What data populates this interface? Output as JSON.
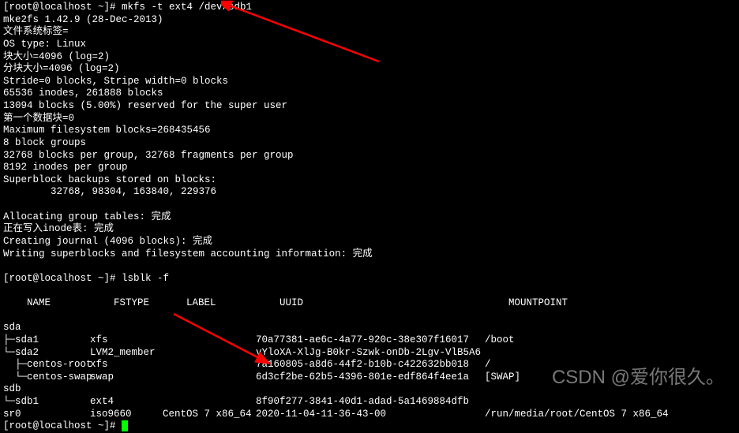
{
  "prompt1": "[root@localhost ~]# ",
  "cmd1": "mkfs -t ext4 /dev/sdb1",
  "mkfs_output": [
    "mke2fs 1.42.9 (28-Dec-2013)",
    "文件系统标签=",
    "OS type: Linux",
    "块大小=4096 (log=2)",
    "分块大小=4096 (log=2)",
    "Stride=0 blocks, Stripe width=0 blocks",
    "65536 inodes, 261888 blocks",
    "13094 blocks (5.00%) reserved for the super user",
    "第一个数据块=0",
    "Maximum filesystem blocks=268435456",
    "8 block groups",
    "32768 blocks per group, 32768 fragments per group",
    "8192 inodes per group",
    "Superblock backups stored on blocks:",
    "        32768, 98304, 163840, 229376",
    "",
    "Allocating group tables: 完成",
    "正在写入inode表: 完成",
    "Creating journal (4096 blocks): 完成",
    "Writing superblocks and filesystem accounting information: 完成",
    ""
  ],
  "prompt2": "[root@localhost ~]# ",
  "cmd2": "lsblk -f",
  "lsblk_header": {
    "c1": "NAME",
    "c2": "FSTYPE",
    "c3": "LABEL",
    "c4": "UUID",
    "c5": "MOUNTPOINT"
  },
  "lsblk_rows": [
    {
      "name": "sda",
      "fstype": "",
      "label": "",
      "uuid": "",
      "mp": ""
    },
    {
      "name": "├─sda1",
      "fstype": "xfs",
      "label": "",
      "uuid": "70a77381-ae6c-4a77-920c-38e307f16017",
      "mp": "/boot"
    },
    {
      "name": "└─sda2",
      "fstype": "LVM2_member",
      "label": "",
      "uuid": "vYloXA-XlJg-B0kr-Szwk-onDb-2Lgv-VlB5A6",
      "mp": ""
    },
    {
      "name": "  ├─centos-root",
      "fstype": "xfs",
      "label": "",
      "uuid": "7a160805-a8d6-44f2-b10b-c422632bb018",
      "mp": "/"
    },
    {
      "name": "  └─centos-swap",
      "fstype": "swap",
      "label": "",
      "uuid": "6d3cf2be-62b5-4396-801e-edf864f4ee1a",
      "mp": "[SWAP]"
    },
    {
      "name": "sdb",
      "fstype": "",
      "label": "",
      "uuid": "",
      "mp": ""
    },
    {
      "name": "└─sdb1",
      "fstype": "ext4",
      "label": "",
      "uuid": "8f90f277-3841-40d1-adad-5a1469884dfb",
      "mp": ""
    },
    {
      "name": "sr0",
      "fstype": "iso9660",
      "label": "CentOS 7 x86_64",
      "uuid": "2020-11-04-11-36-43-00",
      "mp": "/run/media/root/CentOS 7 x86_64"
    }
  ],
  "prompt3": "[root@localhost ~]# ",
  "watermark_text": "CSDN @爱你很久。"
}
